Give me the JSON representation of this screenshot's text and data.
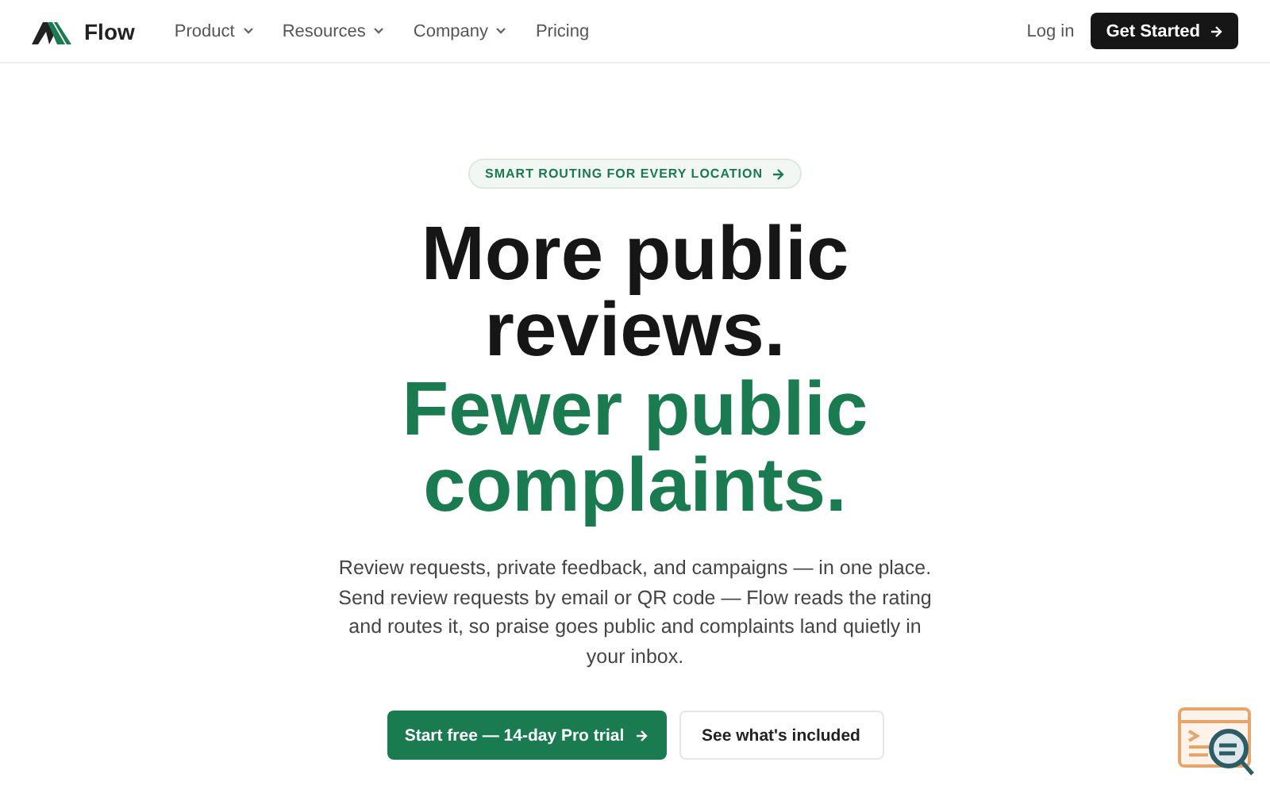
{
  "brand": {
    "name": "Flow"
  },
  "nav": [
    {
      "label": "Product",
      "dropdown": true
    },
    {
      "label": "Resources",
      "dropdown": true
    },
    {
      "label": "Company",
      "dropdown": true
    },
    {
      "label": "Pricing",
      "dropdown": false
    }
  ],
  "actions": {
    "login": "Log in",
    "cta": "Get Started"
  },
  "hero": {
    "badge": "SMART ROUTING FOR EVERY LOCATION",
    "headline": "More public reviews.",
    "headline_accent": "Fewer public complaints.",
    "lines": [
      "Review requests, private feedback, and campaigns — in one place.",
      "Send review requests by email or QR code — Flow reads the rating and routes it, so praise goes public and complaints land quietly in your inbox."
    ],
    "buttons": [
      {
        "label": "Start free — 14-day Pro trial",
        "kind": "primary"
      },
      {
        "label": "See what's included",
        "kind": "secondary"
      }
    ]
  }
}
